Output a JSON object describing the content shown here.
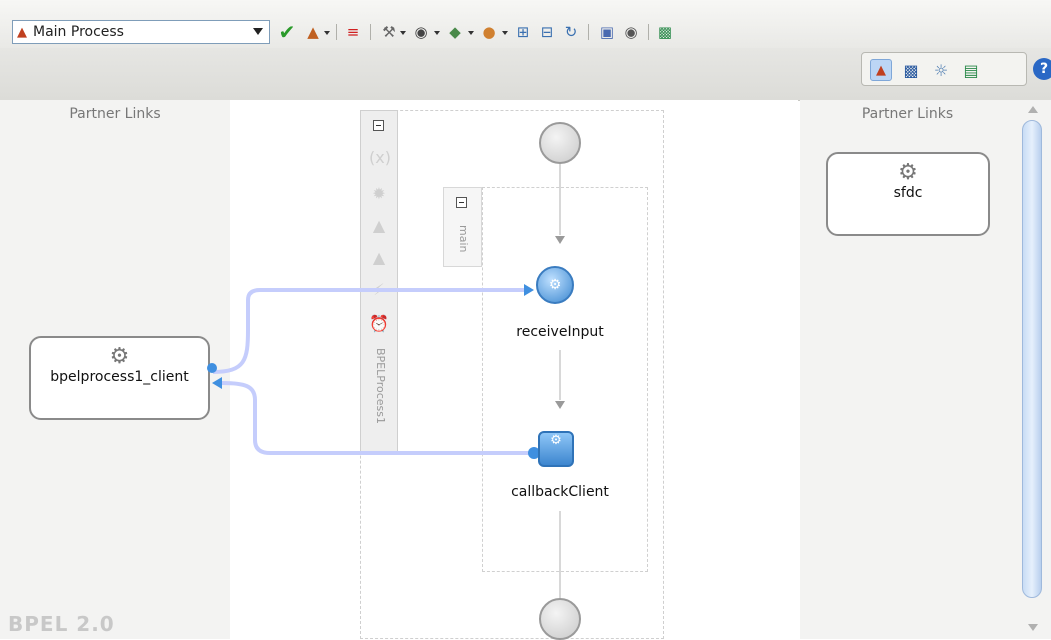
{
  "toolbar": {
    "process_selector": {
      "value": "Main Process"
    }
  },
  "left_lane": {
    "title": "Partner Links",
    "partner": "bpelprocess1_client"
  },
  "right_lane": {
    "title": "Partner Links",
    "partner": "sfdc"
  },
  "scope": {
    "vertical_label": "BPELProcess1",
    "inner_label": "main"
  },
  "activities": {
    "receive": "receiveInput",
    "invoke": "callbackClient"
  },
  "footer": {
    "version_label": "BPEL 2.0"
  },
  "colors": {
    "wire": "#c5cdfc",
    "wire_dot": "#3f8fe0",
    "activity": "#3c88d0"
  }
}
